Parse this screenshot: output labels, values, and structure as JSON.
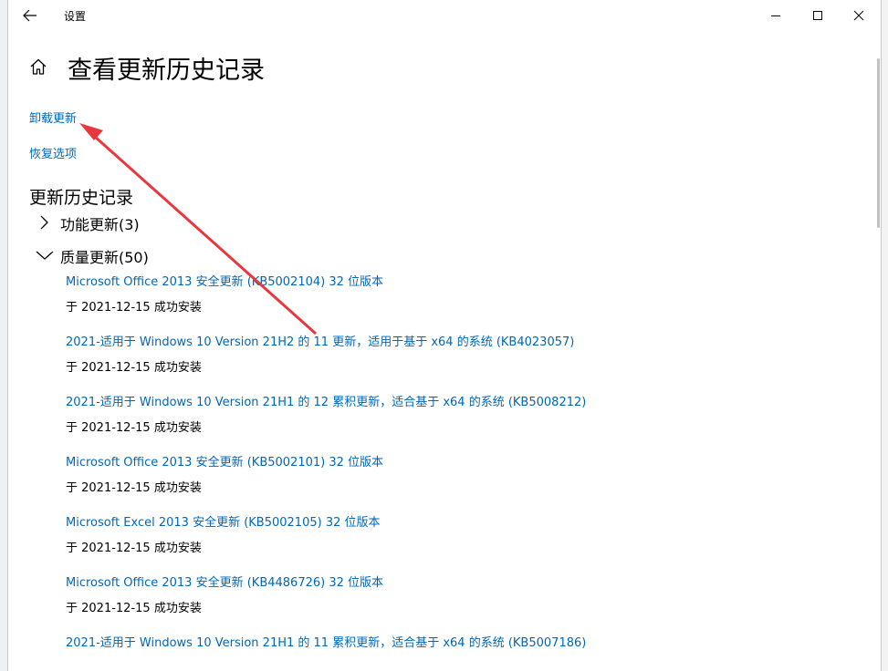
{
  "window": {
    "title": "设置"
  },
  "page": {
    "title": "查看更新历史记录"
  },
  "links": {
    "uninstall": "卸载更新",
    "recovery": "恢复选项"
  },
  "history": {
    "title": "更新历史记录",
    "groups": [
      {
        "label": "功能更新(3)",
        "expanded": false
      },
      {
        "label": "质量更新(50)",
        "expanded": true
      }
    ],
    "quality_updates": [
      {
        "title": "Microsoft Office 2013 安全更新 (KB5002104) 32 位版本",
        "status": "于 2021-12-15 成功安装"
      },
      {
        "title": "2021-适用于 Windows 10 Version 21H2 的 11 更新，适用于基于 x64 的系统 (KB4023057)",
        "status": "于 2021-12-15 成功安装"
      },
      {
        "title": "2021-适用于 Windows 10 Version 21H1 的 12 累积更新，适合基于 x64 的系统 (KB5008212)",
        "status": "于 2021-12-15 成功安装"
      },
      {
        "title": "Microsoft Office 2013 安全更新 (KB5002101) 32 位版本",
        "status": "于 2021-12-15 成功安装"
      },
      {
        "title": "Microsoft Excel 2013 安全更新 (KB5002105) 32 位版本",
        "status": "于 2021-12-15 成功安装"
      },
      {
        "title": "Microsoft Office 2013 安全更新 (KB4486726) 32 位版本",
        "status": "于 2021-12-15 成功安装"
      },
      {
        "title": "2021-适用于 Windows 10 Version 21H1 的 11 累积更新，适合基于 x64 的系统 (KB5007186)",
        "status": ""
      }
    ]
  },
  "colors": {
    "link": "#0067b8",
    "annotation_arrow": "#e8383d",
    "background": "#ffffff"
  },
  "icons": {
    "back": "back-arrow-icon",
    "home": "home-icon",
    "minimize": "minimize-icon",
    "maximize": "maximize-icon",
    "close": "close-icon"
  }
}
